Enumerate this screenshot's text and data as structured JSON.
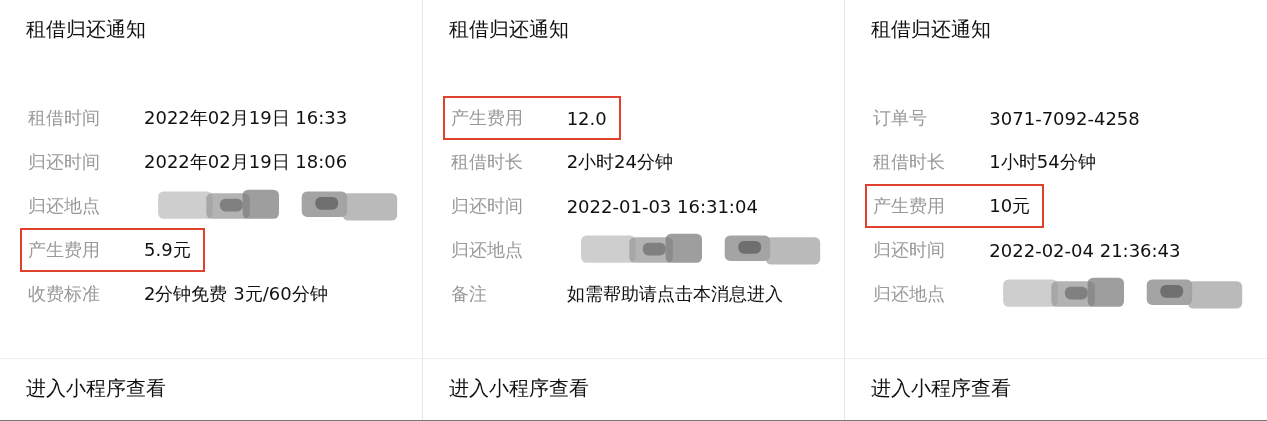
{
  "cards": [
    {
      "title": "租借归还通知",
      "rows": [
        {
          "kind": "text",
          "label": "租借时间",
          "value": "2022年02月19日 16:33",
          "highlighted": false
        },
        {
          "kind": "text",
          "label": "归还时间",
          "value": "2022年02月19日 18:06",
          "highlighted": false
        },
        {
          "kind": "redacted",
          "label": "归还地点",
          "highlighted": false
        },
        {
          "kind": "text",
          "label": "产生费用",
          "value": "5.9元",
          "highlighted": true
        },
        {
          "kind": "text",
          "label": "收费标准",
          "value": "2分钟免费 3元/60分钟",
          "highlighted": false
        }
      ],
      "footer": "进入小程序查看"
    },
    {
      "title": "租借归还通知",
      "rows": [
        {
          "kind": "text",
          "label": "产生费用",
          "value": "12.0",
          "highlighted": true
        },
        {
          "kind": "text",
          "label": "租借时长",
          "value": "2小时24分钟",
          "highlighted": false
        },
        {
          "kind": "text",
          "label": "归还时间",
          "value": "2022-01-03 16:31:04",
          "highlighted": false
        },
        {
          "kind": "redacted",
          "label": "归还地点",
          "highlighted": false
        },
        {
          "kind": "text",
          "label": "备注",
          "value": "如需帮助请点击本消息进入",
          "highlighted": false
        }
      ],
      "footer": "进入小程序查看"
    },
    {
      "title": "租借归还通知",
      "rows": [
        {
          "kind": "text",
          "label": "订单号",
          "value": "3071-7092-4258",
          "highlighted": false
        },
        {
          "kind": "text",
          "label": "租借时长",
          "value": "1小时54分钟",
          "highlighted": false
        },
        {
          "kind": "text",
          "label": "产生费用",
          "value": "10元",
          "highlighted": true
        },
        {
          "kind": "text",
          "label": "归还时间",
          "value": "2022-02-04 21:36:43",
          "highlighted": false
        },
        {
          "kind": "redacted",
          "label": "归还地点",
          "highlighted": false
        }
      ],
      "footer": "进入小程序查看"
    }
  ]
}
